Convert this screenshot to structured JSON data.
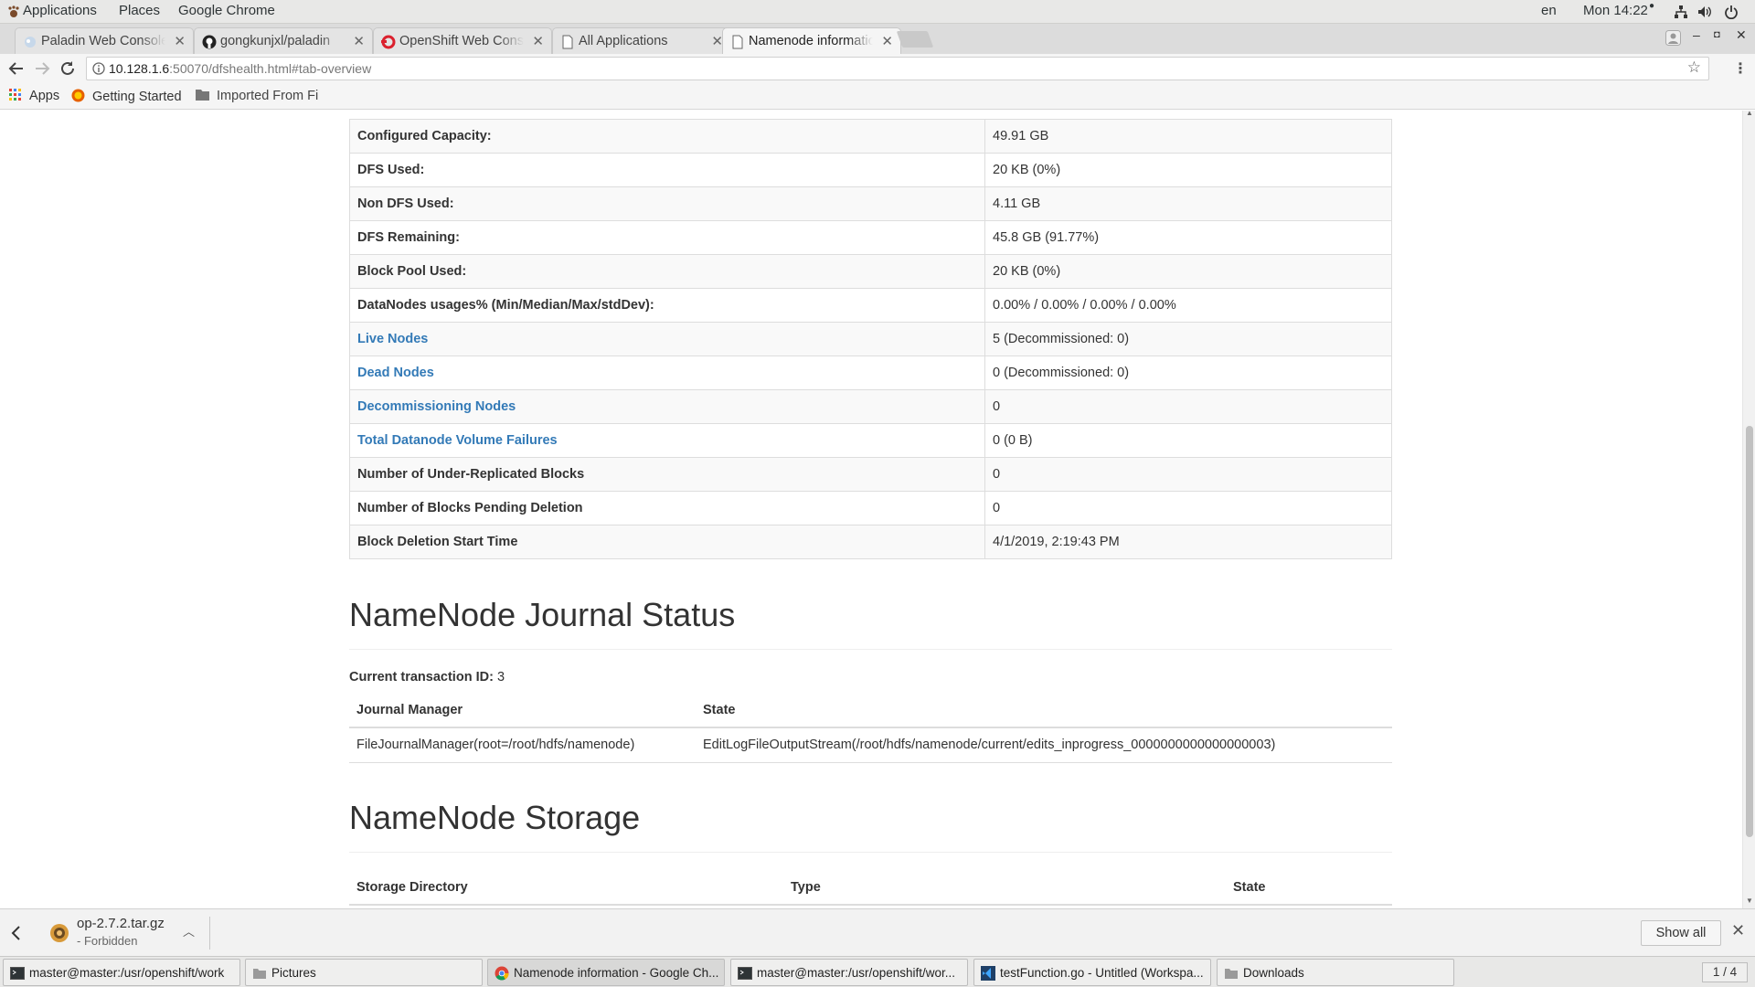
{
  "system_bar": {
    "menus": [
      "Applications",
      "Places",
      "Google Chrome"
    ],
    "language": "en",
    "clock": "Mon 14:22"
  },
  "tabs": [
    {
      "title": "Paladin Web Console",
      "active": false
    },
    {
      "title": "gongkunjxl/paladin",
      "active": false
    },
    {
      "title": "OpenShift Web Console",
      "active": false
    },
    {
      "title": "All Applications",
      "active": false
    },
    {
      "title": "Namenode information",
      "active": true
    }
  ],
  "address_bar": {
    "host": "10.128.1.6",
    "rest": ":50070/dfshealth.html#tab-overview"
  },
  "bookmarks": [
    "Apps",
    "Getting Started",
    "Imported From Fi"
  ],
  "summary_rows": [
    {
      "key": "Configured Capacity:",
      "value": "49.91 GB",
      "link": false
    },
    {
      "key": "DFS Used:",
      "value": "20 KB (0%)",
      "link": false
    },
    {
      "key": "Non DFS Used:",
      "value": "4.11 GB",
      "link": false
    },
    {
      "key": "DFS Remaining:",
      "value": "45.8 GB (91.77%)",
      "link": false
    },
    {
      "key": "Block Pool Used:",
      "value": "20 KB (0%)",
      "link": false
    },
    {
      "key": "DataNodes usages% (Min/Median/Max/stdDev):",
      "value": "0.00% / 0.00% / 0.00% / 0.00%",
      "link": false
    },
    {
      "key": "Live Nodes",
      "value": "5 (Decommissioned: 0)",
      "link": true
    },
    {
      "key": "Dead Nodes",
      "value": "0 (Decommissioned: 0)",
      "link": true
    },
    {
      "key": "Decommissioning Nodes",
      "value": "0",
      "link": true
    },
    {
      "key": "Total Datanode Volume Failures",
      "value": "0 (0 B)",
      "link": true
    },
    {
      "key": "Number of Under-Replicated Blocks",
      "value": "0",
      "link": false
    },
    {
      "key": "Number of Blocks Pending Deletion",
      "value": "0",
      "link": false
    },
    {
      "key": "Block Deletion Start Time",
      "value": "4/1/2019, 2:19:43 PM",
      "link": false
    }
  ],
  "journal": {
    "heading": "NameNode Journal Status",
    "txn_label": "Current transaction ID:",
    "txn_value": "3",
    "col_manager": "Journal Manager",
    "col_state": "State",
    "manager": "FileJournalManager(root=/root/hdfs/namenode)",
    "state": "EditLogFileOutputStream(/root/hdfs/namenode/current/edits_inprogress_0000000000000000003)"
  },
  "storage": {
    "heading": "NameNode Storage",
    "col_dir": "Storage Directory",
    "col_type": "Type",
    "col_state": "State"
  },
  "download": {
    "name": "op-2.7.2.tar.gz",
    "status": "- Forbidden",
    "show_all": "Show all"
  },
  "taskbar": [
    {
      "label": "master@master:/usr/openshift/work",
      "icon": "terminal-icon",
      "active": false
    },
    {
      "label": "Pictures",
      "icon": "folder-icon",
      "active": false
    },
    {
      "label": "Namenode information - Google Ch...",
      "icon": "chrome-icon",
      "active": true
    },
    {
      "label": "master@master:/usr/openshift/wor...",
      "icon": "terminal-icon",
      "active": false
    },
    {
      "label": "testFunction.go - Untitled (Workspa...",
      "icon": "vscode-icon",
      "active": false
    },
    {
      "label": "Downloads",
      "icon": "folder-icon",
      "active": false
    }
  ],
  "workspace": "1 / 4",
  "colors": {
    "link": "#337ab7",
    "table_stripe": "#f9f9f9"
  }
}
